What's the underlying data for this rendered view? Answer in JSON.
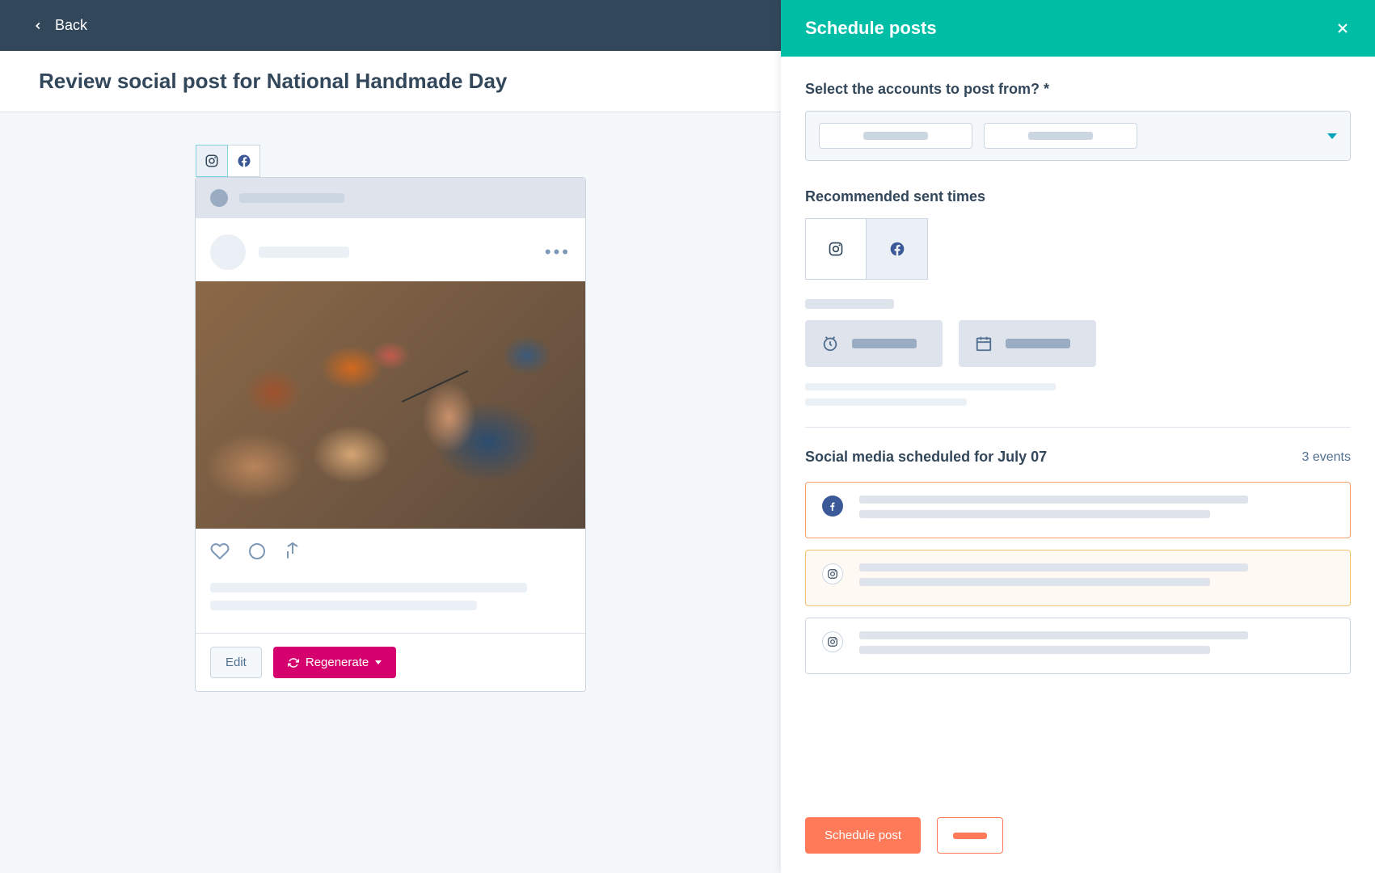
{
  "topbar": {
    "back_label": "Back"
  },
  "title": "Review social post for National Handmade Day",
  "preview": {
    "platforms": [
      "instagram",
      "facebook"
    ],
    "active_platform": "instagram",
    "buttons": {
      "edit": "Edit",
      "regenerate": "Regenerate"
    }
  },
  "panel": {
    "title": "Schedule posts",
    "accounts_label": "Select the accounts to post from? *",
    "recommended_label": "Recommended sent times",
    "time_tabs": [
      "instagram",
      "facebook"
    ],
    "scheduled": {
      "label": "Social media scheduled for July 07",
      "count_text": "3 events",
      "events": [
        {
          "network": "facebook"
        },
        {
          "network": "instagram"
        },
        {
          "network": "instagram"
        }
      ]
    },
    "footer": {
      "primary": "Schedule post"
    }
  },
  "colors": {
    "teal": "#00bda5",
    "orange": "#ff7a59",
    "pink": "#d5006d",
    "navy": "#33475b"
  }
}
